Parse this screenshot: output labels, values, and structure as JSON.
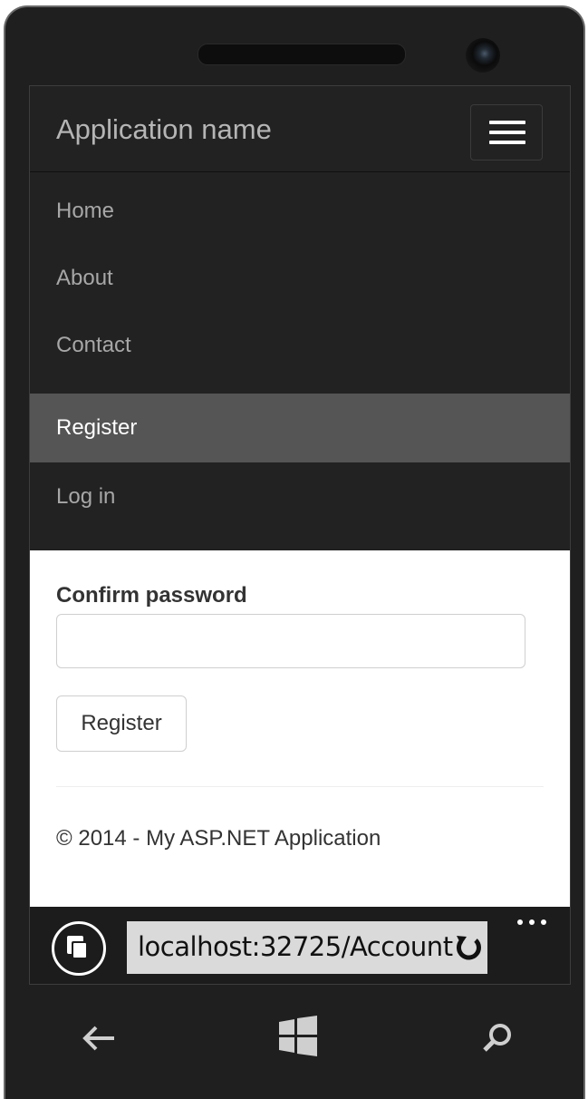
{
  "app": {
    "brand": "Application name",
    "menu_toggle_icon": "hamburger-icon"
  },
  "nav": {
    "items": [
      {
        "label": "Home",
        "active": false
      },
      {
        "label": "About",
        "active": false
      },
      {
        "label": "Contact",
        "active": false
      },
      {
        "label": "Register",
        "active": true
      },
      {
        "label": "Log in",
        "active": false
      }
    ]
  },
  "form": {
    "confirm_password_label": "Confirm password",
    "confirm_password_value": "",
    "register_button": "Register"
  },
  "footer": {
    "text": "© 2014 - My ASP.NET Application"
  },
  "browser": {
    "url": "localhost:32725/Account",
    "icons": [
      "tabs-icon",
      "refresh-icon",
      "more-icon"
    ]
  },
  "device": {
    "buttons": [
      "back-arrow-icon",
      "windows-start-icon",
      "search-icon"
    ]
  },
  "colors": {
    "navbar_bg": "#222222",
    "active_item_bg": "#555555",
    "address_bar_bg": "#dadada"
  }
}
